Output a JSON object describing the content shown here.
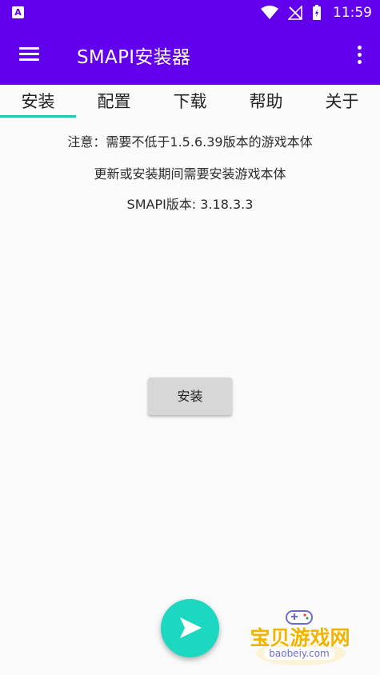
{
  "statusbar": {
    "app_icon_letter": "A",
    "time": "11:59"
  },
  "appbar": {
    "title": "SMAPI安装器"
  },
  "tabs": [
    {
      "label": "安装"
    },
    {
      "label": "配置"
    },
    {
      "label": "下载"
    },
    {
      "label": "帮助"
    },
    {
      "label": "关于"
    }
  ],
  "content": {
    "line1": "注意：需要不低于1.5.6.39版本的游戏本体",
    "line2": "更新或安装期间需要安装游戏本体",
    "line3": "SMAPI版本: 3.18.3.3",
    "install_button": "安装"
  },
  "watermark": {
    "title": "宝贝游戏网",
    "url": "baobeiy.com"
  },
  "colors": {
    "primary": "#6200ee",
    "accent": "#1dd8c0",
    "tab_indicator": "#26c6b0"
  }
}
